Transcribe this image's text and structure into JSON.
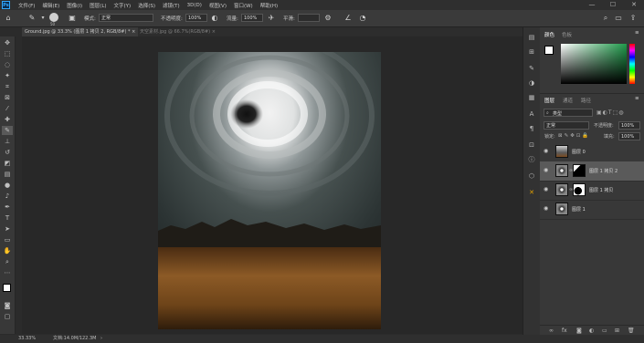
{
  "menu": {
    "logo": "Ps",
    "items": [
      "文件(F)",
      "编辑(E)",
      "图像(I)",
      "图层(L)",
      "文字(Y)",
      "选择(S)",
      "滤镜(T)",
      "3D(D)",
      "视图(V)",
      "窗口(W)",
      "帮助(H)"
    ],
    "minimize": "—",
    "maximize": "☐",
    "close": "✕"
  },
  "options": {
    "brush_size": "50",
    "mode_label": "模式:",
    "mode_value": "正常",
    "opacity_label": "不透明度:",
    "opacity_value": "100%",
    "flow_label": "流量:",
    "flow_value": "100%",
    "smoothing_label": "平滑:"
  },
  "tabs": [
    {
      "label": "Ground.jpg @ 33.3% (图层 1 拷贝 2, RGB/8#) *  ×"
    },
    {
      "label": "天空素材.jpg @ 66.7%(RGB/8#)  ×"
    }
  ],
  "status": {
    "zoom": "33.33%",
    "doc": "文档:14.0M/122.3M"
  },
  "color_panel": {
    "tab1": "颜色",
    "tab2": "色板",
    "base_hex": "#1f9a4a"
  },
  "layers_panel": {
    "tab1": "图层",
    "tab2": "通道",
    "tab3": "路径",
    "search_placeholder": "类型",
    "blend_mode": "正常",
    "opacity_label": "不透明度:",
    "opacity_value": "100%",
    "lock_label": "锁定:",
    "fill_label": "填充:",
    "fill_value": "100%",
    "layers": [
      {
        "name": "图层 0",
        "selected": false
      },
      {
        "name": "图层 1 拷贝 2",
        "selected": true
      },
      {
        "name": "图层 1 拷贝",
        "selected": false
      },
      {
        "name": "图层 1",
        "selected": false
      }
    ]
  },
  "colors": {
    "accent": "#31a8ff",
    "annotation_arrow": "#e02020"
  }
}
